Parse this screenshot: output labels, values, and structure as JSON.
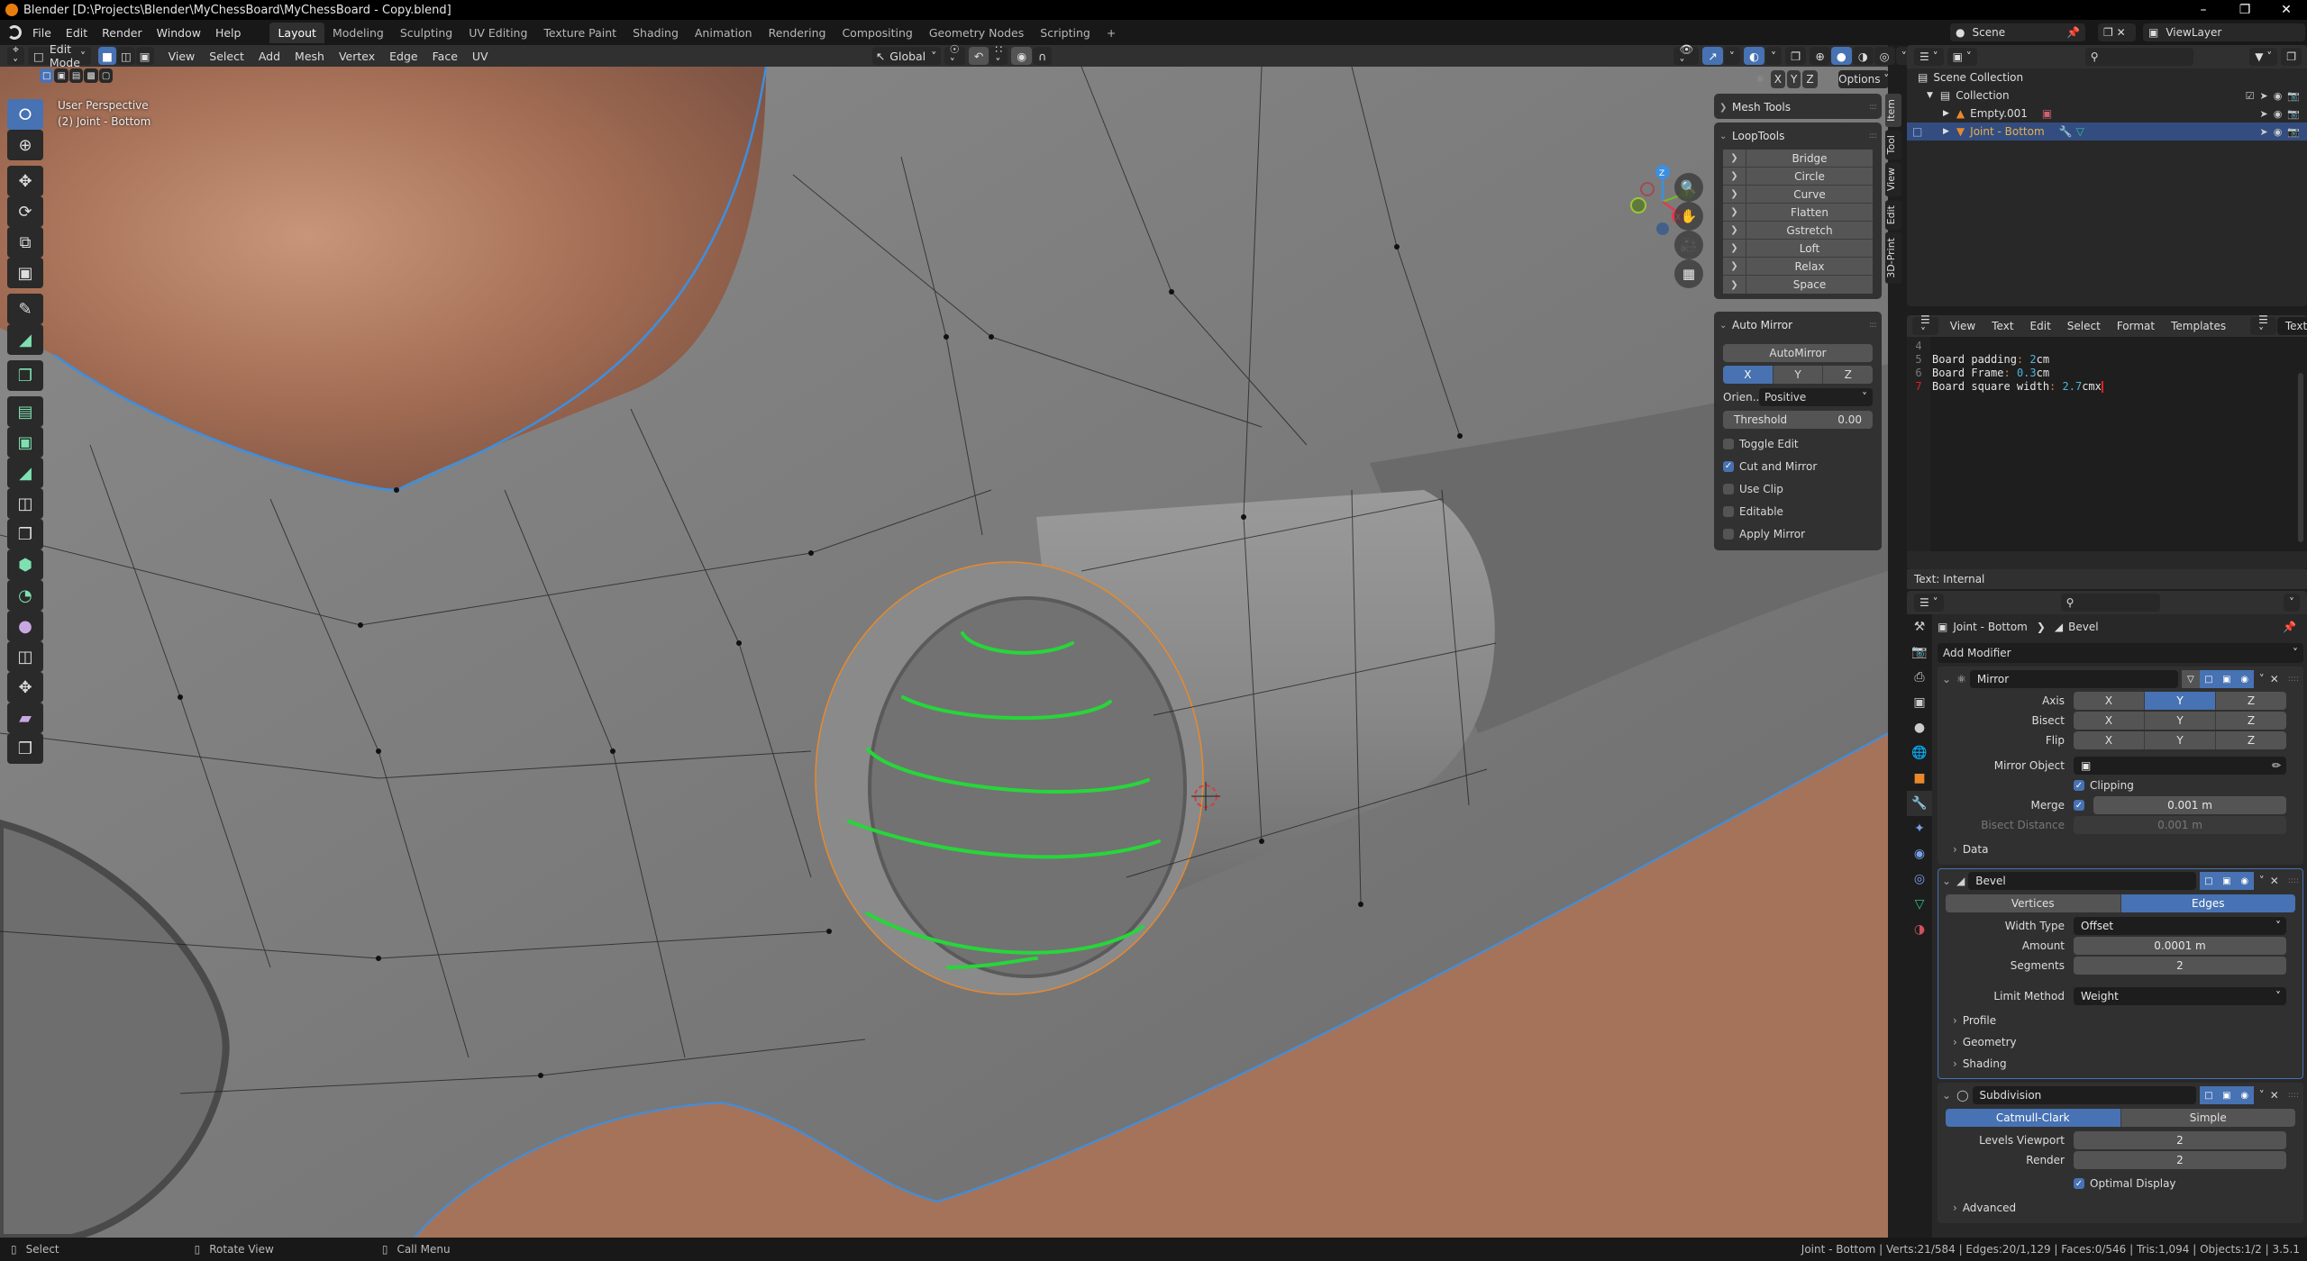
{
  "window": {
    "title": "Blender [D:\\Projects\\Blender\\MyChessBoard\\MyChessBoard - Copy.blend]",
    "controls": [
      "minimize",
      "maximize",
      "close"
    ]
  },
  "menubar": {
    "menus": [
      "File",
      "Edit",
      "Render",
      "Window",
      "Help"
    ],
    "workspaces": [
      "Layout",
      "Modeling",
      "Sculpting",
      "UV Editing",
      "Texture Paint",
      "Shading",
      "Animation",
      "Rendering",
      "Compositing",
      "Geometry Nodes",
      "Scripting"
    ],
    "active_workspace": "Layout",
    "add_label": "+"
  },
  "scene": {
    "name": "Scene",
    "view_layer": "ViewLayer"
  },
  "viewport_header": {
    "mode": "Edit Mode",
    "menus": [
      "View",
      "Select",
      "Add",
      "Mesh",
      "Vertex",
      "Edge",
      "Face",
      "UV"
    ],
    "orientation": "Global",
    "options_label": "Options",
    "mirror_axes": [
      "X",
      "Y",
      "Z"
    ]
  },
  "viewport": {
    "info_line1": "User Perspective",
    "info_line2": "(2) Joint - Bottom",
    "gizmo_axes": {
      "x": "X",
      "y": "Y",
      "z": "Z"
    },
    "colors": {
      "mesh": "#7a7a7a",
      "texture": "#a5735a",
      "boundary": "#3d8fe0",
      "selected": "#e8892c",
      "annotation": "#27d63a"
    }
  },
  "n_panel": {
    "tabs": [
      "Item",
      "Tool",
      "View",
      "Edit",
      "3D-Print"
    ],
    "mesh_tools": {
      "title": "Mesh Tools"
    },
    "looptools": {
      "title": "LoopTools",
      "items": [
        "Bridge",
        "Circle",
        "Curve",
        "Flatten",
        "Gstretch",
        "Loft",
        "Relax",
        "Space"
      ]
    },
    "auto_mirror": {
      "title": "Auto Mirror",
      "button": "AutoMirror",
      "axes": [
        "X",
        "Y",
        "Z"
      ],
      "active_axis": "X",
      "orientation_label": "Orien...",
      "orientation_value": "Positive",
      "threshold_label": "Threshold",
      "threshold_value": "0.00",
      "options": [
        {
          "label": "Toggle Edit",
          "checked": false
        },
        {
          "label": "Cut and Mirror",
          "checked": true
        },
        {
          "label": "Use Clip",
          "checked": false
        },
        {
          "label": "Editable",
          "checked": false
        },
        {
          "label": "Apply Mirror",
          "checked": false
        }
      ]
    }
  },
  "outliner": {
    "root": "Scene Collection",
    "items": [
      {
        "name": "Collection",
        "level": 1
      },
      {
        "name": "Empty.001",
        "level": 2
      },
      {
        "name": "Joint - Bottom",
        "level": 2,
        "selected": true
      }
    ]
  },
  "text_editor": {
    "menus": [
      "View",
      "Text",
      "Edit",
      "Select",
      "Format",
      "Templates"
    ],
    "datablock": "Text",
    "lines": [
      {
        "n": "4",
        "key": "",
        "sep": "",
        "num": "",
        "unit": ""
      },
      {
        "n": "5",
        "key": "Board padding",
        "sep": ":",
        "num": "2",
        "unit": "cm"
      },
      {
        "n": "6",
        "key": "Board Frame",
        "sep": ":",
        "num": "0.3",
        "unit": "cm"
      },
      {
        "n": "7",
        "key": "Board square width",
        "sep": ":",
        "num": "2.7",
        "unit": "cmx"
      }
    ],
    "current_line": "7",
    "footer": "Text: Internal"
  },
  "properties": {
    "breadcrumb_object": "Joint - Bottom",
    "breadcrumb_modifier": "Bevel",
    "add_modifier": "Add Modifier",
    "mirror": {
      "name": "Mirror",
      "axis_label": "Axis",
      "bisect_label": "Bisect",
      "flip_label": "Flip",
      "axis_active": "Y",
      "xyz": [
        "X",
        "Y",
        "Z"
      ],
      "mirror_object_label": "Mirror Object",
      "clipping_label": "Clipping",
      "clipping": true,
      "merge_label": "Merge",
      "merge": true,
      "merge_value": "0.001 m",
      "bisect_distance_label": "Bisect Distance",
      "bisect_distance_value": "0.001 m",
      "data_label": "Data"
    },
    "bevel": {
      "name": "Bevel",
      "modes": [
        "Vertices",
        "Edges"
      ],
      "active_mode": "Edges",
      "width_type_label": "Width Type",
      "width_type": "Offset",
      "amount_label": "Amount",
      "amount": "0.0001 m",
      "segments_label": "Segments",
      "segments": "2",
      "limit_method_label": "Limit Method",
      "limit_method": "Weight",
      "subpanels": [
        "Profile",
        "Geometry",
        "Shading"
      ]
    },
    "subdivision": {
      "name": "Subdivision",
      "modes": [
        "Catmull-Clark",
        "Simple"
      ],
      "active_mode": "Catmull-Clark",
      "levels_viewport_label": "Levels Viewport",
      "levels_viewport": "2",
      "render_label": "Render",
      "render": "2",
      "optimal_display_label": "Optimal Display",
      "optimal_display": true,
      "advanced_label": "Advanced"
    }
  },
  "statusbar": {
    "hints": [
      "Select",
      "Rotate View",
      "Call Menu"
    ],
    "stats": "Joint - Bottom | Verts:21/584 | Edges:20/1,129 | Faces:0/546 | Tris:1,094 | Objects:1/2 | 3.5.1"
  }
}
